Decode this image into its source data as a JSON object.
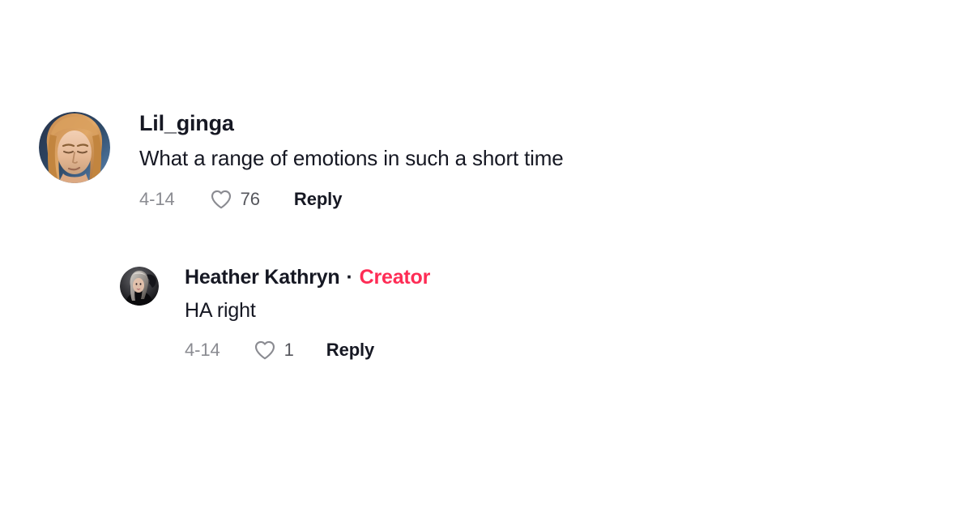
{
  "theme": {
    "background": "#ffffff",
    "text_primary": "#161823",
    "text_muted": "#8a8b91",
    "text_count": "#55565c",
    "accent_creator": "#fe2c55",
    "heart_outline": "#8a8b91"
  },
  "comment": {
    "username": "Lil_ginga",
    "avatar_alt": "photo of person with long reddish-blond hair",
    "text": "What a range of emotions in such a short time",
    "date": "4-14",
    "like_count": "76",
    "reply_label": "Reply",
    "heart_icon": "heart-outline-icon"
  },
  "reply": {
    "username": "Heather Kathryn",
    "separator": "·",
    "badge": "Creator",
    "avatar_alt": "dark photo of woman with long hair",
    "text": "HA right",
    "date": "4-14",
    "like_count": "1",
    "reply_label": "Reply",
    "heart_icon": "heart-outline-icon"
  }
}
